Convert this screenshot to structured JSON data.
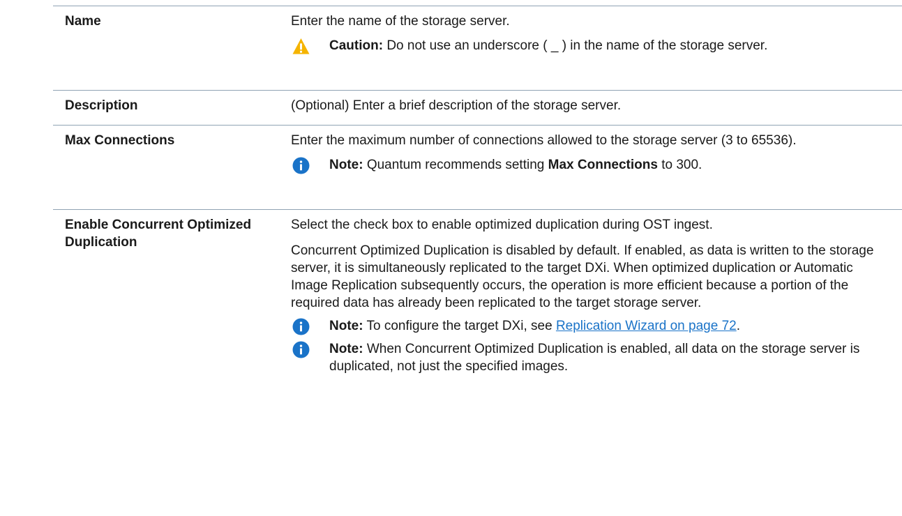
{
  "rows": [
    {
      "term": "Name",
      "desc": "Enter the name of the storage server.",
      "note": {
        "icon": "caution-icon",
        "lead": "Caution:",
        "text": " Do not use an underscore ( _ ) in the name of the storage server."
      }
    },
    {
      "term": "Description",
      "desc": "(Optional) Enter a brief description of the storage server."
    },
    {
      "term": "Max Connections",
      "desc": "Enter the maximum number of connections allowed to the storage server (3 to 65536).",
      "note": {
        "icon": "info-icon",
        "lead": "Note:",
        "text_before": " Quantum recommends setting ",
        "bold": "Max Connections",
        "text_after": " to 300."
      }
    },
    {
      "term": "Enable Concurrent Optimized Duplication",
      "desc1": "Select the check box to enable optimized duplication during OST ingest.",
      "desc2": "Concurrent Optimized Duplication is disabled by default. If enabled, as data is written to the storage server, it is simultaneously replicated to the target DXi. When optimized duplication or Automatic Image Replication subsequently occurs, the operation is more efficient because a portion of the required data has already been replicated to the target storage server.",
      "note1": {
        "icon": "info-icon",
        "lead": "Note:",
        "text": " To configure the target DXi, see ",
        "link": "Replication Wizard on page 72",
        "text_after": "."
      },
      "note2": {
        "icon": "info-icon",
        "lead": "Note:",
        "text": " When Concurrent Optimized Duplication is enabled, all data on the storage server is duplicated, not just the specified images."
      }
    }
  ],
  "colors": {
    "caution": "#f5b400",
    "info": "#1a73c8",
    "link": "#1a73c8",
    "rule": "#8fa3b3"
  }
}
